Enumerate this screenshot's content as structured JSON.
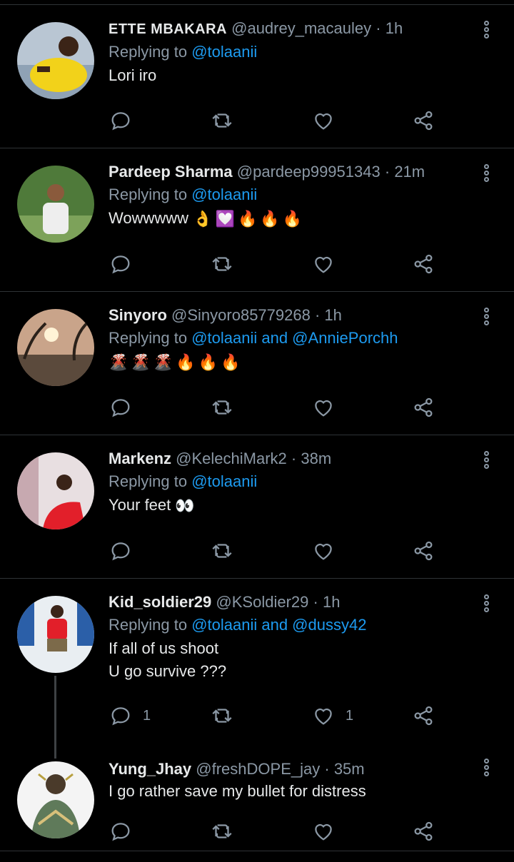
{
  "tweets": [
    {
      "name": "ETTE MBAKARA",
      "handle": "@audrey_macauley",
      "sep": "·",
      "time": "1h",
      "replying_prefix": "Replying to",
      "mentions": "@tolaanii",
      "text": "Lori iro",
      "reply_count": "",
      "like_count": ""
    },
    {
      "name": "Pardeep Sharma",
      "handle": "@pardeep99951343",
      "sep": "·",
      "time": "21m",
      "replying_prefix": "Replying to",
      "mentions": "@tolaanii",
      "text": "Wowwwww",
      "reply_count": "",
      "like_count": ""
    },
    {
      "name": "Sinyoro",
      "handle": "@Sinyoro85779268",
      "sep": "·",
      "time": "1h",
      "replying_prefix": "Replying to",
      "mentions": "@tolaanii and @AnniePorchh",
      "text": "",
      "reply_count": "",
      "like_count": ""
    },
    {
      "name": "Markenz",
      "handle": "@KelechiMark2",
      "sep": "·",
      "time": "38m",
      "replying_prefix": "Replying to",
      "mentions": "@tolaanii",
      "text": "Your feet",
      "reply_count": "",
      "like_count": ""
    },
    {
      "name": "Kid_soldier29",
      "handle": "@KSoldier29",
      "sep": "·",
      "time": "1h",
      "replying_prefix": "Replying to",
      "mentions": "@tolaanii and @dussy42",
      "text": "If all of us shoot\nU go survive ???",
      "reply_count": "1",
      "like_count": "1"
    },
    {
      "name": "Yung_Jhay",
      "handle": "@freshDOPE_jay",
      "sep": "·",
      "time": "35m",
      "replying_prefix": "",
      "mentions": "",
      "text": "I go rather save my bullet for distress",
      "reply_count": "",
      "like_count": ""
    }
  ],
  "colors": {
    "background": "#000000",
    "accent": "#1d9bf0",
    "muted": "#8b98a5",
    "divider": "#2f3336"
  },
  "icons": [
    "reply-icon",
    "retweet-icon",
    "like-icon",
    "share-icon",
    "more-options-icon"
  ]
}
